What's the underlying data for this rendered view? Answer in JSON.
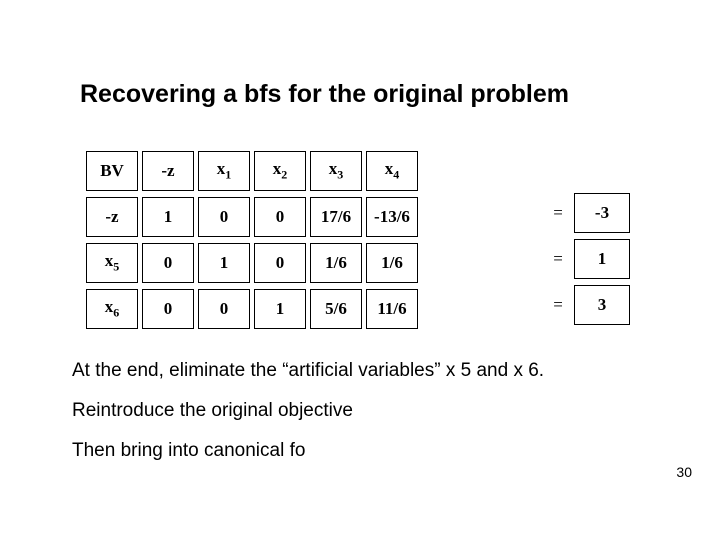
{
  "title": "Recovering a bfs for the original problem",
  "tableau": {
    "headers": [
      "BV",
      "-z",
      "x1",
      "x2",
      "x3",
      "x4"
    ],
    "rows": [
      {
        "bv": "-z",
        "cells": [
          "1",
          "0",
          "0",
          "17/6",
          "-13/6"
        ],
        "rhs": "-3"
      },
      {
        "bv": "x5",
        "cells": [
          "0",
          "1",
          "0",
          "1/6",
          "1/6"
        ],
        "rhs": "1"
      },
      {
        "bv": "x6",
        "cells": [
          "0",
          "0",
          "1",
          "5/6",
          "11/6"
        ],
        "rhs": "3"
      }
    ],
    "eq": "="
  },
  "body": {
    "line1": "At the end, eliminate the “artificial variables” x 5 and x 6.",
    "line2": "Reintroduce the original objective",
    "line3": "Then bring into canonical fo"
  },
  "page": "30"
}
